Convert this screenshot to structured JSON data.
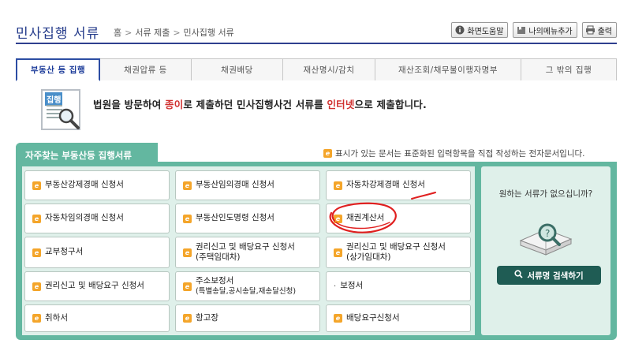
{
  "header": {
    "title": "민사집행 서류",
    "breadcrumb": [
      "홈",
      "서류 제출",
      "민사집행 서류"
    ],
    "tools": [
      {
        "label": "화면도움말",
        "icon": "info-icon"
      },
      {
        "label": "나의메뉴추가",
        "icon": "bookmark-icon"
      },
      {
        "label": "출력",
        "icon": "printer-icon"
      }
    ]
  },
  "tabs": [
    {
      "label": "부동산 등 집행",
      "active": true
    },
    {
      "label": "채권압류 등",
      "active": false
    },
    {
      "label": "채권배당",
      "active": false
    },
    {
      "label": "재산명시/감치",
      "active": false
    },
    {
      "label": "재산조회/채무불이행자명부",
      "active": false
    },
    {
      "label": "그 밖의 집행",
      "active": false
    }
  ],
  "intro": {
    "icon_label": "집행",
    "text_1": "법원을 방문하여 ",
    "text_hl1": "종이",
    "text_2": "로 제출하던 민사집행사건 서류를 ",
    "text_hl2": "인터넷",
    "text_3": "으로 제출합니다."
  },
  "panel": {
    "title": "자주찾는 부동산등 집행서류",
    "notice": "표시가 있는 문서는 표준화된 입력항목을 직접 작성하는 전자문서입니다.",
    "items": [
      {
        "label": "부동산강제경매 신청서",
        "e": true
      },
      {
        "label": "부동산임의경매 신청서",
        "e": true
      },
      {
        "label": "자동차강제경매 신청서",
        "e": true
      },
      {
        "label": "자동차임의경매 신청서",
        "e": true
      },
      {
        "label": "부동산인도명령 신청서",
        "e": true
      },
      {
        "label": "채권계산서",
        "e": true
      },
      {
        "label": "교부청구서",
        "e": true
      },
      {
        "label": "권리신고 및 배당요구 신청서",
        "sub": "(주택임대차)",
        "e": true
      },
      {
        "label": "권리신고 및 배당요구 신청서",
        "sub": "(상가임대차)",
        "e": true
      },
      {
        "label": "권리신고 및 배당요구 신청서",
        "e": true
      },
      {
        "label": "주소보정서",
        "sub": "(특별송달,공시송달,재송달신청)",
        "e": true
      },
      {
        "label": "보정서",
        "e": false
      },
      {
        "label": "취하서",
        "e": true
      },
      {
        "label": "항고장",
        "e": true
      },
      {
        "label": "배당요구신청서",
        "e": true
      }
    ],
    "side": {
      "question": "원하는 서류가 없으십니까?",
      "button": "서류명 검색하기"
    }
  },
  "colors": {
    "accent": "#2c4da3",
    "panel": "#63b7a0",
    "panel_inner": "#dff0ea",
    "search_button": "#1f5c54",
    "highlight": "#d0302f",
    "e_doc_icon": "#f4a52a"
  }
}
